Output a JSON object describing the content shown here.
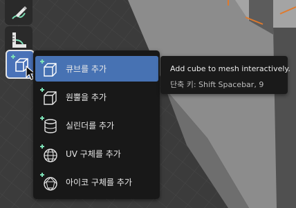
{
  "colors": {
    "viewport_bg": "#3a3a3a",
    "menu_bg": "#181818",
    "selected_bg": "#4772b3",
    "icon_accent": "#7de0b6",
    "tooltip_bg": "#1a1a1a",
    "mesh_wire": "#e07a2c"
  },
  "toolbar": {
    "tools": [
      {
        "icon": "annotate-pen-icon"
      },
      {
        "icon": "measure-ruler-icon"
      },
      {
        "icon": "add-cube-icon",
        "active": true
      }
    ]
  },
  "menu": {
    "items": [
      {
        "label": "큐브를 추가",
        "icon": "cube-icon",
        "selected": true
      },
      {
        "label": "원뿔을 추가",
        "icon": "cone-icon",
        "selected": false
      },
      {
        "label": "실린더를 추가",
        "icon": "cylinder-icon",
        "selected": false
      },
      {
        "label": "UV 구체를 추가",
        "icon": "uv-sphere-icon",
        "selected": false
      },
      {
        "label": "아이코 구체를 추가",
        "icon": "ico-sphere-icon",
        "selected": false
      }
    ]
  },
  "tooltip": {
    "description": "Add cube to mesh interactively.",
    "shortcut": "단축 키: Shift Spacebar, 9"
  }
}
